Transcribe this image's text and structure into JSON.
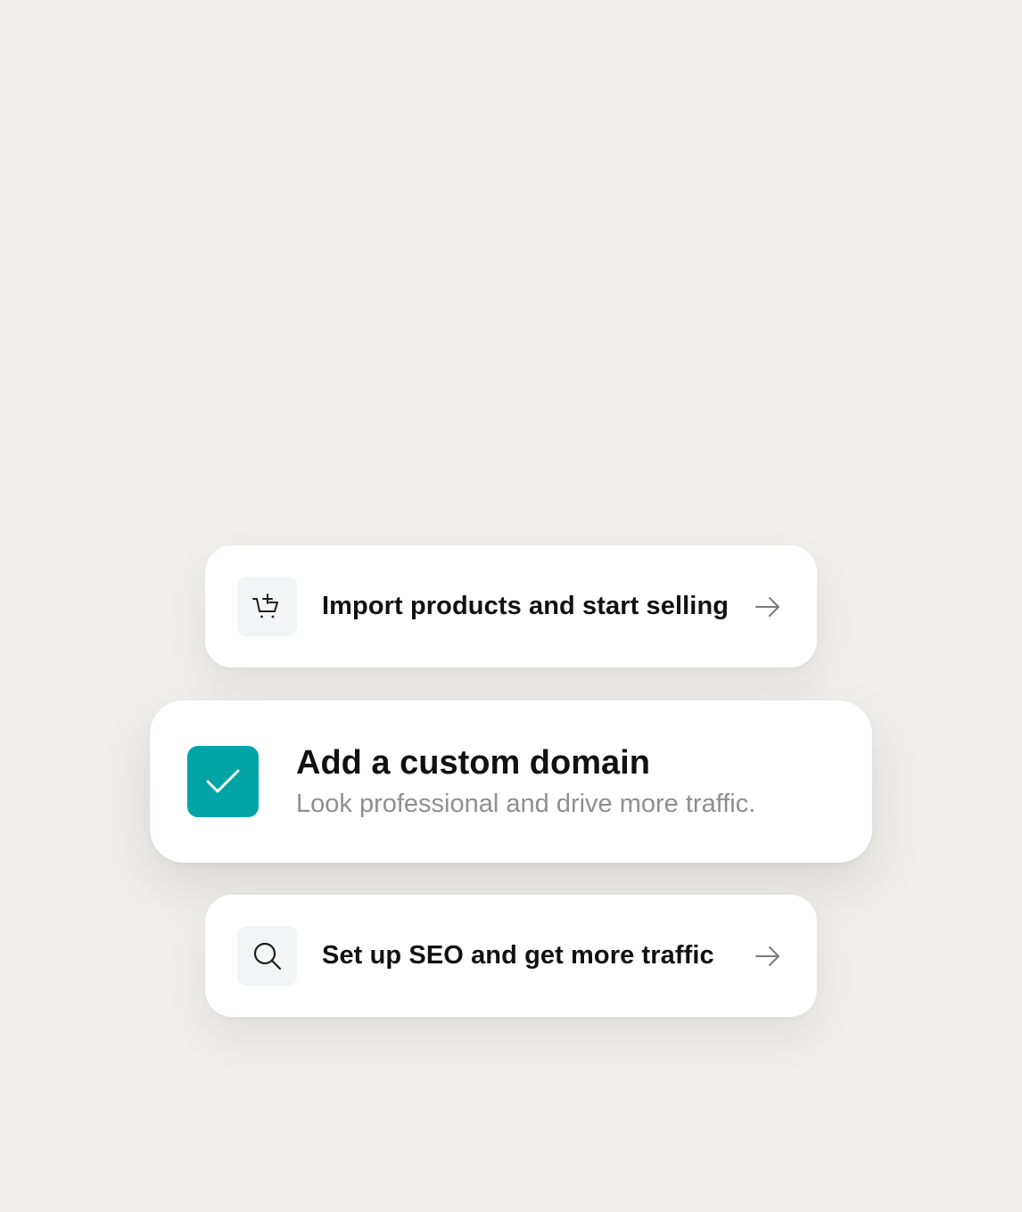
{
  "colors": {
    "background": "#f0efeb",
    "card": "#ffffff",
    "accent": "#00a4a6",
    "title_text": "#111111",
    "subtitle_text": "#8f8f8f"
  },
  "tasks": [
    {
      "icon": "cart-plus-icon",
      "label": "Import products and start selling",
      "action_icon": "arrow-right-icon"
    },
    {
      "icon": "checkmark-icon",
      "completed": true,
      "title": "Add a custom domain",
      "subtitle": "Look professional and drive more traffic."
    },
    {
      "icon": "search-icon",
      "label": "Set up SEO and get more traffic",
      "action_icon": "arrow-right-icon"
    }
  ]
}
